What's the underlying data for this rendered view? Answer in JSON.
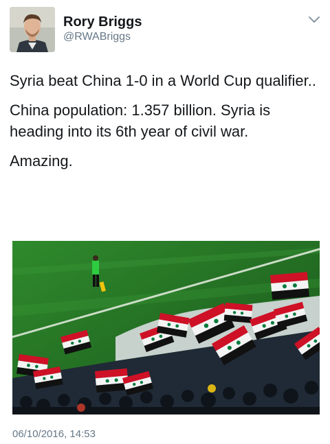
{
  "user": {
    "display_name": "Rory Briggs",
    "handle": "@RWABriggs",
    "avatar_icon": "profile-photo"
  },
  "tweet": {
    "paragraphs": [
      "Syria beat China 1-0 in a World Cup qualifier..",
      "China population: 1.357 billion. Syria is heading into its 6th year of civil war.",
      "Amazing."
    ],
    "timestamp": "06/10/2016, 14:53"
  },
  "menu": {
    "icon": "chevron-down-icon"
  },
  "colors": {
    "text": "#14171a",
    "secondary": "#657786",
    "pitch": "#2e7d2a",
    "flag_red": "#ce1126",
    "flag_black": "#111111",
    "flag_star": "#007a3d"
  }
}
